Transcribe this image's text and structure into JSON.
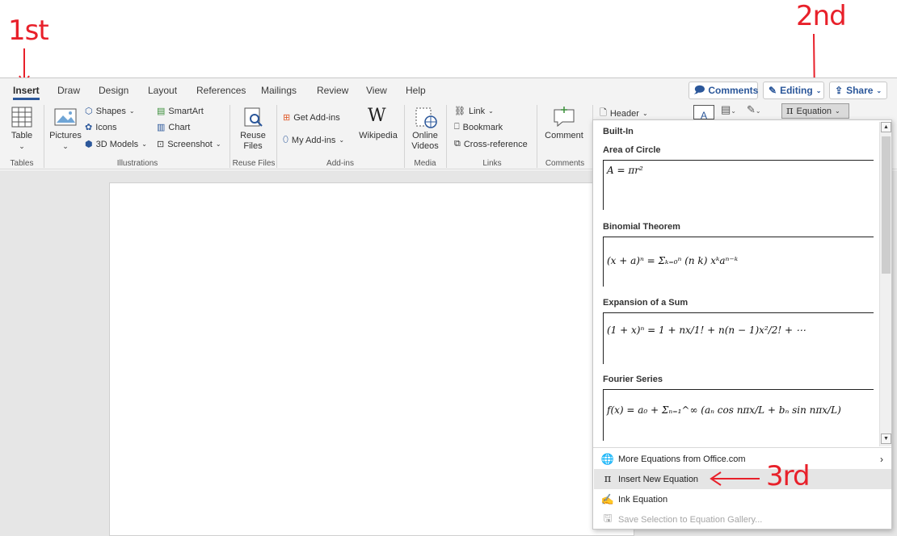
{
  "annotations": {
    "first": "1st",
    "second": "2nd",
    "third": "3rd"
  },
  "tabs": [
    "Insert",
    "Draw",
    "Design",
    "Layout",
    "References",
    "Mailings",
    "Review",
    "View",
    "Help"
  ],
  "top_buttons": {
    "comments": "Comments",
    "editing": "Editing",
    "share": "Share"
  },
  "ribbon": {
    "table": "Table",
    "pictures": "Pictures",
    "shapes": "Shapes",
    "icons": "Icons",
    "models3d": "3D Models",
    "smartart": "SmartArt",
    "chart": "Chart",
    "screenshot": "Screenshot",
    "reuse_line1": "Reuse",
    "reuse_line2": "Files",
    "get_addins": "Get Add-ins",
    "my_addins": "My Add-ins",
    "wikipedia": "Wikipedia",
    "online_line1": "Online",
    "online_line2": "Videos",
    "link": "Link",
    "bookmark": "Bookmark",
    "crossref": "Cross-reference",
    "comment": "Comment",
    "header": "Header",
    "equation": "Equation",
    "groups": {
      "tables": "Tables",
      "illustrations": "Illustrations",
      "reuse": "Reuse Files",
      "addins": "Add-ins",
      "media": "Media",
      "links": "Links",
      "comments": "Comments"
    }
  },
  "dropdown": {
    "builtin": "Built-In",
    "equations": [
      {
        "title": "Area of Circle",
        "formula": "A = πr²"
      },
      {
        "title": "Binomial Theorem",
        "formula": "(x + a)ⁿ = Σₖ₌₀ⁿ (n k) xᵏaⁿ⁻ᵏ"
      },
      {
        "title": "Expansion of a Sum",
        "formula": "(1 + x)ⁿ = 1 + nx/1! + n(n − 1)x²/2! + ⋯"
      },
      {
        "title": "Fourier Series",
        "formula": "f(x) = a₀ + Σₙ₌₁^∞ (aₙ cos nπx/L + bₙ sin nπx/L)"
      }
    ],
    "menu": {
      "more": "More Equations from Office.com",
      "insert": "Insert New Equation",
      "ink": "Ink Equation",
      "save": "Save Selection to Equation Gallery..."
    }
  },
  "colors": {
    "accent": "#2b579a",
    "annotation": "#e8202a",
    "ribbon": "#f3f3f3",
    "highlight": "#e5e5e5"
  },
  "icons": [
    "table-icon",
    "pictures-icon",
    "shapes-icon",
    "icons-icon",
    "3d-models-icon",
    "smartart-icon",
    "chart-icon",
    "screenshot-icon",
    "reuse-files-icon",
    "add-ins-icon",
    "wikipedia-icon",
    "online-videos-icon",
    "link-icon",
    "bookmark-icon",
    "cross-reference-icon",
    "comment-icon",
    "header-icon",
    "equation-icon",
    "globe-icon",
    "pi-icon",
    "ink-equation-icon",
    "save-icon"
  ]
}
